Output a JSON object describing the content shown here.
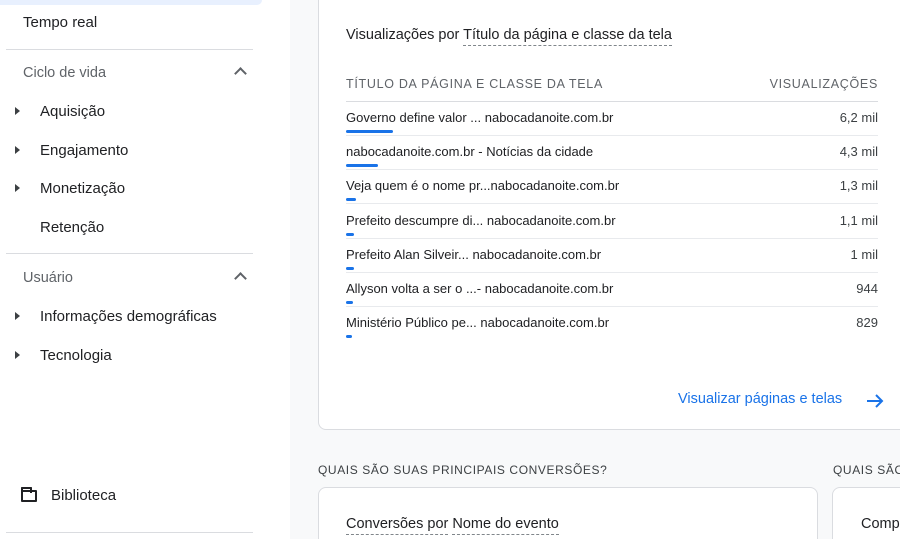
{
  "sidebar": {
    "realtime_label": "Tempo real",
    "lifecycle": {
      "label": "Ciclo de vida",
      "items": [
        "Aquisição",
        "Engajamento",
        "Monetização",
        "Retenção"
      ]
    },
    "user": {
      "label": "Usuário",
      "items": [
        "Informações demográficas",
        "Tecnologia"
      ]
    },
    "library_label": "Biblioteca"
  },
  "card": {
    "title_prefix": "Visualizações por",
    "title_dimension": "Título da página e classe da tela",
    "col_title": "TÍTULO DA PÁGINA E CLASSE DA TELA",
    "col_views": "VISUALIZAÇÕES",
    "rows": [
      {
        "name": "Governo define valor ... nabocadanoite.com.br",
        "value": "6,2 mil",
        "share": 1.0
      },
      {
        "name": "nabocadanoite.com.br - Notícias da cidade",
        "value": "4,3 mil",
        "share": 0.69
      },
      {
        "name": "Veja quem é o nome pr...nabocadanoite.com.br",
        "value": "1,3 mil",
        "share": 0.21
      },
      {
        "name": "Prefeito descumpre di... nabocadanoite.com.br",
        "value": "1,1 mil",
        "share": 0.18
      },
      {
        "name": "Prefeito Alan Silveir... nabocadanoite.com.br",
        "value": "1 mil",
        "share": 0.16
      },
      {
        "name": "Allyson volta a ser o ...- nabocadanoite.com.br",
        "value": "944",
        "share": 0.15
      },
      {
        "name": "Ministério Público pe... nabocadanoite.com.br",
        "value": "829",
        "share": 0.13
      }
    ],
    "link_label": "Visualizar páginas e telas"
  },
  "conversions": {
    "section_title": "QUAIS SÃO SUAS PRINCIPAIS CONVERSÕES?",
    "card_prefix": "Conversões por",
    "card_dimension": "Nome do evento"
  },
  "next_section": {
    "section_title": "QUAIS SÃO",
    "card_title": "Comp"
  },
  "colors": {
    "accent": "#1a73e8",
    "text": "#202124",
    "muted": "#5f6368",
    "divider": "#dadce0"
  },
  "icons": {
    "library": "folder-icon",
    "link_arrow": "arrow-right-icon",
    "section_toggle": "chevron-up-icon",
    "item_expand": "caret-right-icon"
  }
}
